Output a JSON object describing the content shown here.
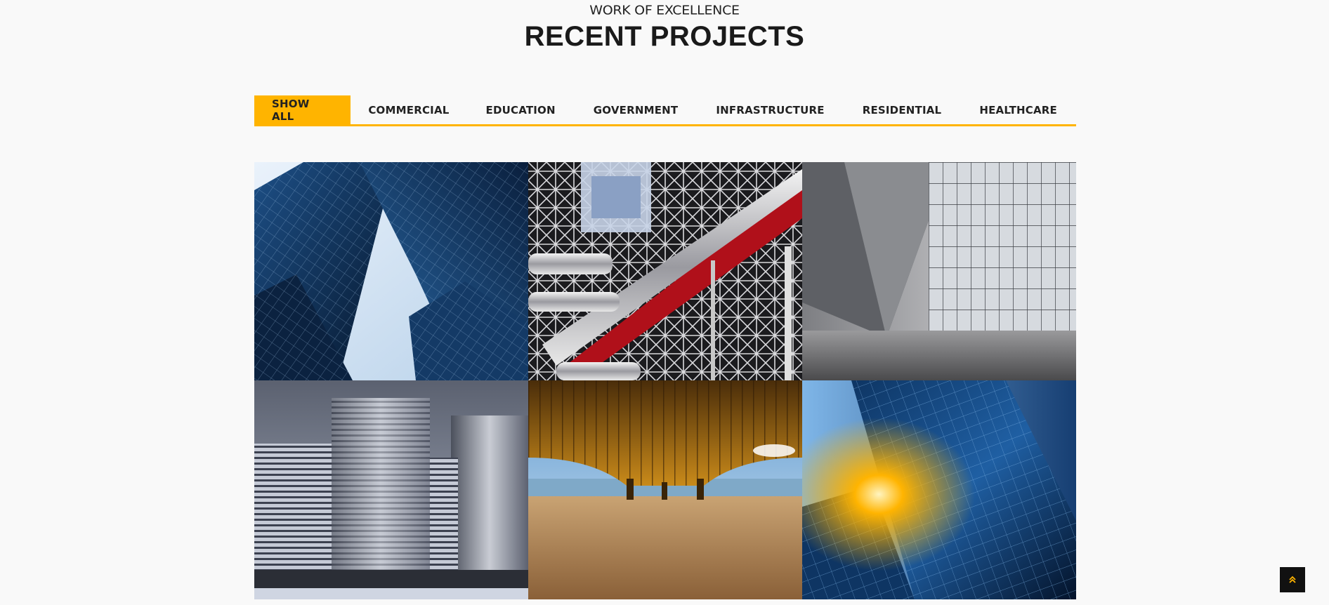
{
  "section": {
    "subtitle": "WORK OF EXCELLENCE",
    "title": "RECENT PROJECTS"
  },
  "filters": [
    {
      "label": "SHOW ALL",
      "active": true
    },
    {
      "label": "COMMERCIAL",
      "active": false
    },
    {
      "label": "EDUCATION",
      "active": false
    },
    {
      "label": "GOVERNMENT",
      "active": false
    },
    {
      "label": "INFRASTRUCTURE",
      "active": false
    },
    {
      "label": "RESIDENTIAL",
      "active": false
    },
    {
      "label": "HEALTHCARE",
      "active": false
    }
  ],
  "colors": {
    "accent": "#ffb400",
    "background": "#f9f9f9",
    "text": "#1a1a1a"
  },
  "back_to_top": {
    "icon": "double-chevron-up-icon"
  }
}
